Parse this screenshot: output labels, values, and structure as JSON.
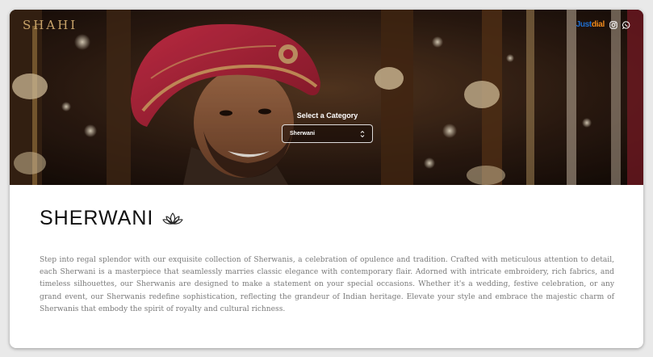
{
  "brand": {
    "logo_text": "SHAHI",
    "color": "#c9a46a"
  },
  "header": {
    "socials": [
      {
        "name": "justdial",
        "label_part1": "Just",
        "label_part2": "dial"
      },
      {
        "name": "instagram-icon"
      },
      {
        "name": "whatsapp-icon"
      }
    ]
  },
  "category": {
    "label": "Select a Category",
    "selected": "Sherwani"
  },
  "content": {
    "title": "SHERWANI",
    "description": "Step into regal splendor with our exquisite collection of Sherwanis, a celebration of opulence and tradition. Crafted with meticulous attention to detail, each Sherwani is a masterpiece that seamlessly marries classic elegance with contemporary flair. Adorned with intricate embroidery, rich fabrics, and timeless silhouettes, our Sherwanis are designed to make a statement on your special occasions. Whether it's a wedding, festive celebration, or any grand event, our Sherwanis redefine sophistication, reflecting the grandeur of Indian heritage. Elevate your style and embrace the majestic charm of Sherwanis that embody the spirit of royalty and cultural richness."
  },
  "colors": {
    "hero_dark": "#2a1a12",
    "turban_red": "#b3243a",
    "text_body": "#7a7a7a",
    "title": "#111111"
  }
}
